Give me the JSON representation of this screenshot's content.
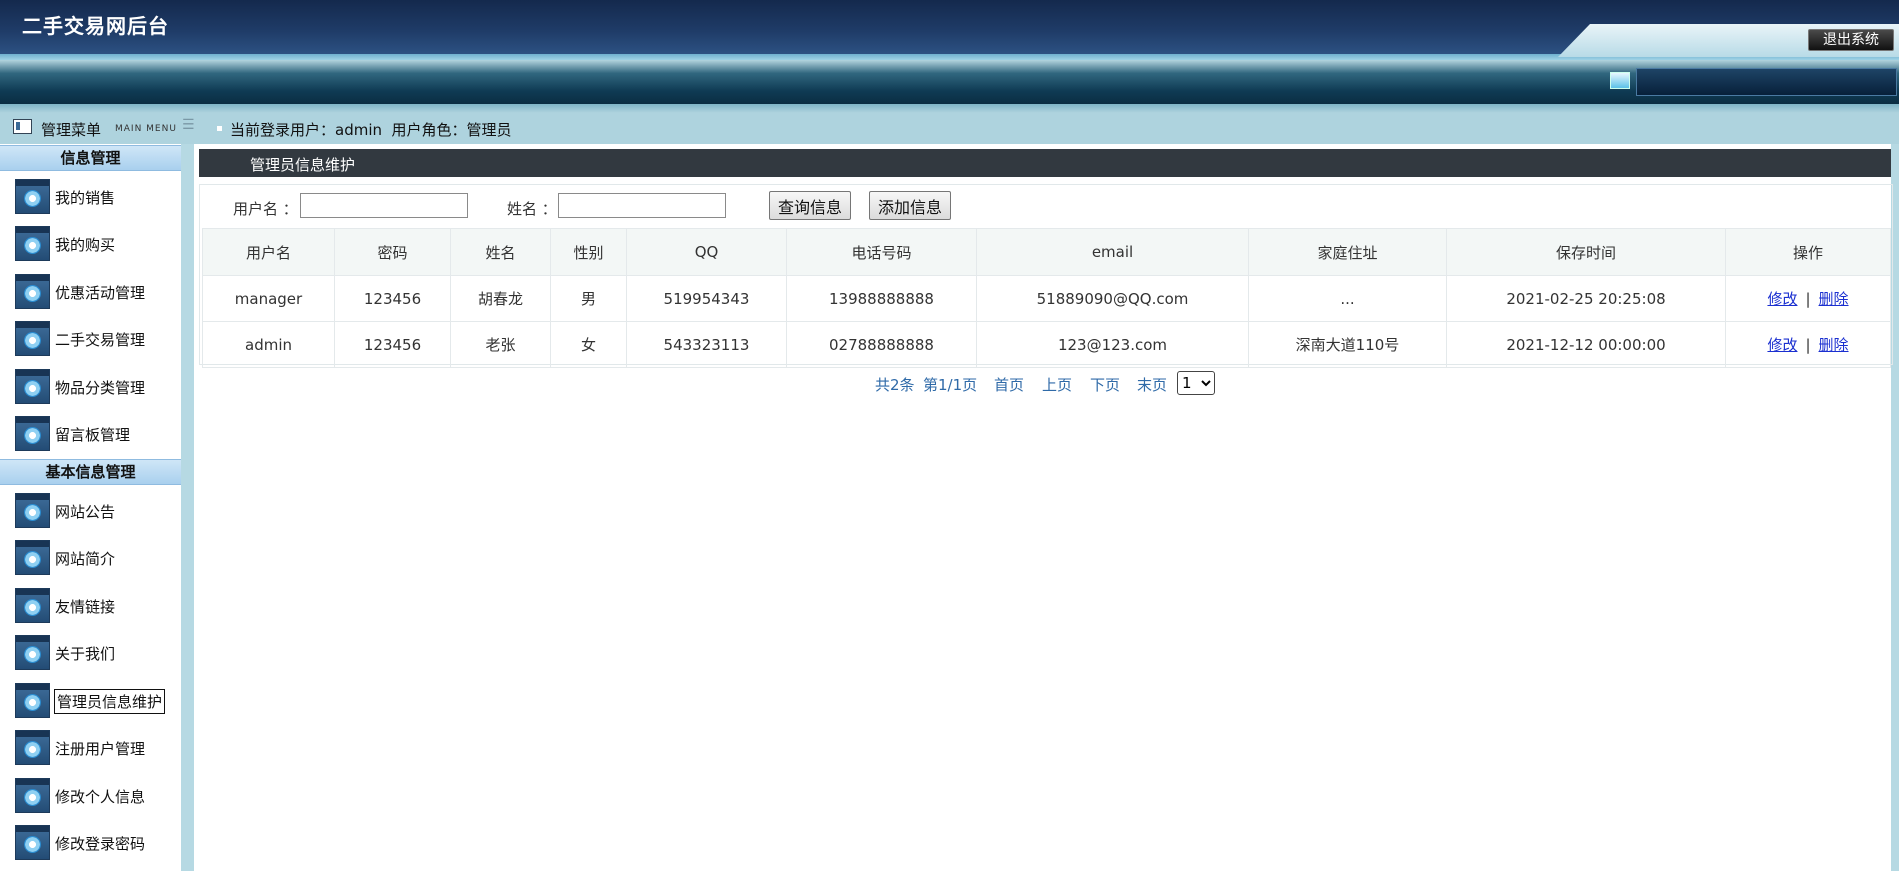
{
  "header": {
    "app_title": "二手交易网后台",
    "logout_label": "退出系统"
  },
  "menu_header": {
    "title": "管理菜单",
    "subtitle": "MAIN MENU"
  },
  "login_info": {
    "text": "当前登录用户：admin  用户角色：管理员"
  },
  "sidebar": {
    "groups": [
      {
        "title": "信息管理",
        "items": [
          {
            "label": "我的销售"
          },
          {
            "label": "我的购买"
          },
          {
            "label": "优惠活动管理"
          },
          {
            "label": "二手交易管理"
          },
          {
            "label": "物品分类管理"
          },
          {
            "label": "留言板管理"
          }
        ]
      },
      {
        "title": "基本信息管理",
        "items": [
          {
            "label": "网站公告"
          },
          {
            "label": "网站简介"
          },
          {
            "label": "友情链接"
          },
          {
            "label": "关于我们"
          },
          {
            "label": "管理员信息维护",
            "active": true
          },
          {
            "label": "注册用户管理"
          },
          {
            "label": "修改个人信息"
          },
          {
            "label": "修改登录密码"
          }
        ]
      }
    ]
  },
  "panel": {
    "title": "管理员信息维护"
  },
  "search": {
    "username_label": "用户名 ：",
    "username_value": "",
    "name_label": "姓名 ：",
    "name_value": "",
    "query_button": "查询信息",
    "add_button": "添加信息"
  },
  "table": {
    "headers": [
      "用户名",
      "密码",
      "姓名",
      "性别",
      "QQ",
      "电话号码",
      "email",
      "家庭住址",
      "保存时间",
      "操作"
    ],
    "rows": [
      {
        "username": "manager",
        "password": "123456",
        "name": "胡春龙",
        "gender": "男",
        "qq": "519954343",
        "phone": "13988888888",
        "email": "51889090@QQ.com",
        "address": "...",
        "saved_time": "2021-02-25 20:25:08",
        "edit": "修改",
        "sep": "|",
        "delete": "删除"
      },
      {
        "username": "admin",
        "password": "123456",
        "name": "老张",
        "gender": "女",
        "qq": "543323113",
        "phone": "02788888888",
        "email": "123@123.com",
        "address": "深南大道110号",
        "saved_time": "2021-12-12 00:00:00",
        "edit": "修改",
        "sep": "|",
        "delete": "删除"
      }
    ]
  },
  "pagination": {
    "total": "共2条",
    "page": "第1/1页",
    "first": "首页",
    "prev": "上页",
    "next": "下页",
    "last": "末页",
    "select_value": "1"
  }
}
